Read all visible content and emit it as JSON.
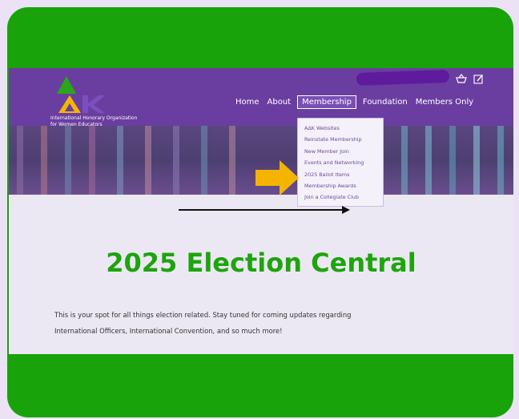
{
  "logo": {
    "letters": "AΔK",
    "caption_line1": "International Honorary Organization",
    "caption_line2": "for Women Educators"
  },
  "nav": {
    "items": [
      "Home",
      "About",
      "Membership",
      "Foundation",
      "Members Only"
    ],
    "active": "Membership"
  },
  "icons": [
    "basket-icon",
    "edit-icon"
  ],
  "dropdown": {
    "items": [
      "AΔK Websites",
      "Reinstate Membership",
      "New Member Join",
      "Events and Networking",
      "2025 Ballot Items",
      "Membership Awards",
      "Join a Collegiate Club"
    ]
  },
  "page": {
    "title": "2025 Election Central",
    "body_line1": "This is your spot for all things election related. Stay tuned for coming updates regarding",
    "body_line2": "International Officers, International Convention, and so much more!"
  },
  "colors": {
    "frame_green": "#19a30b",
    "header_purple": "#6a3ea0",
    "title_green": "#1ea40e",
    "annotation_yellow": "#f5b400",
    "background": "#ebe2f6"
  }
}
